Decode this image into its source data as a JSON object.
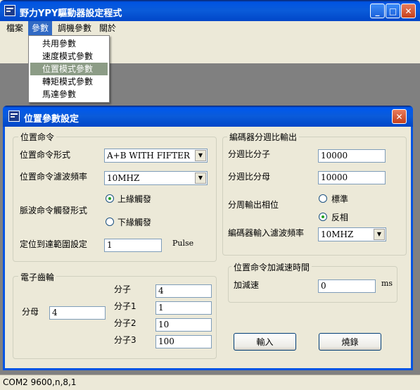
{
  "main_window": {
    "title": "野力YPY驅動器設定程式"
  },
  "menubar": {
    "items": [
      "檔案",
      "參數",
      "調機參數",
      "關於"
    ]
  },
  "params_menu": {
    "items": [
      "共用參數",
      "速度模式參數",
      "位置模式參數",
      "轉矩模式參數",
      "馬達參數"
    ],
    "highlighted_index": 2
  },
  "dialog": {
    "title": "位置參數設定",
    "position_command": {
      "group_label": "位置命令",
      "format_label": "位置命令形式",
      "format_value": "A+B WITH FIFTER",
      "filter_label": "位置命令濾波頻率",
      "filter_value": "10MHZ",
      "trigger_label": "脈波命令觸發形式",
      "trigger_options": [
        "上緣觸發",
        "下緣觸發"
      ],
      "trigger_selected": 0,
      "range_label": "定位到達範圍設定",
      "range_value": "1",
      "range_unit": "Pulse"
    },
    "encoder_output": {
      "group_label": "編碼器分週比輸出",
      "numerator_label": "分週比分子",
      "numerator_value": "10000",
      "denominator_label": "分週比分母",
      "denominator_value": "10000",
      "phase_label": "分周輸出相位",
      "phase_options": [
        "標準",
        "反相"
      ],
      "phase_selected": 1,
      "filter_label": "編碼器輸入濾波頻率",
      "filter_value": "10MHZ"
    },
    "electronic_gear": {
      "group_label": "電子齒輪",
      "denominator_label": "分母",
      "denominator_value": "4",
      "numerators": [
        {
          "label": "分子",
          "value": "4"
        },
        {
          "label": "分子1",
          "value": "1"
        },
        {
          "label": "分子2",
          "value": "10"
        },
        {
          "label": "分子3",
          "value": "100"
        }
      ]
    },
    "accel": {
      "group_label": "位置命令加減速時間",
      "label": "加減速",
      "value": "0",
      "unit": "ms"
    },
    "buttons": {
      "input": "輸入",
      "burn": "燒錄"
    }
  },
  "statusbar": {
    "text": "COM2 9600,n,8,1"
  },
  "colors": {
    "title_blue": "#0054e3",
    "menu_highlight": "#316ac5",
    "dropdown_highlight": "#8c9c86",
    "client_bg": "#808080",
    "face": "#ece9d8"
  }
}
